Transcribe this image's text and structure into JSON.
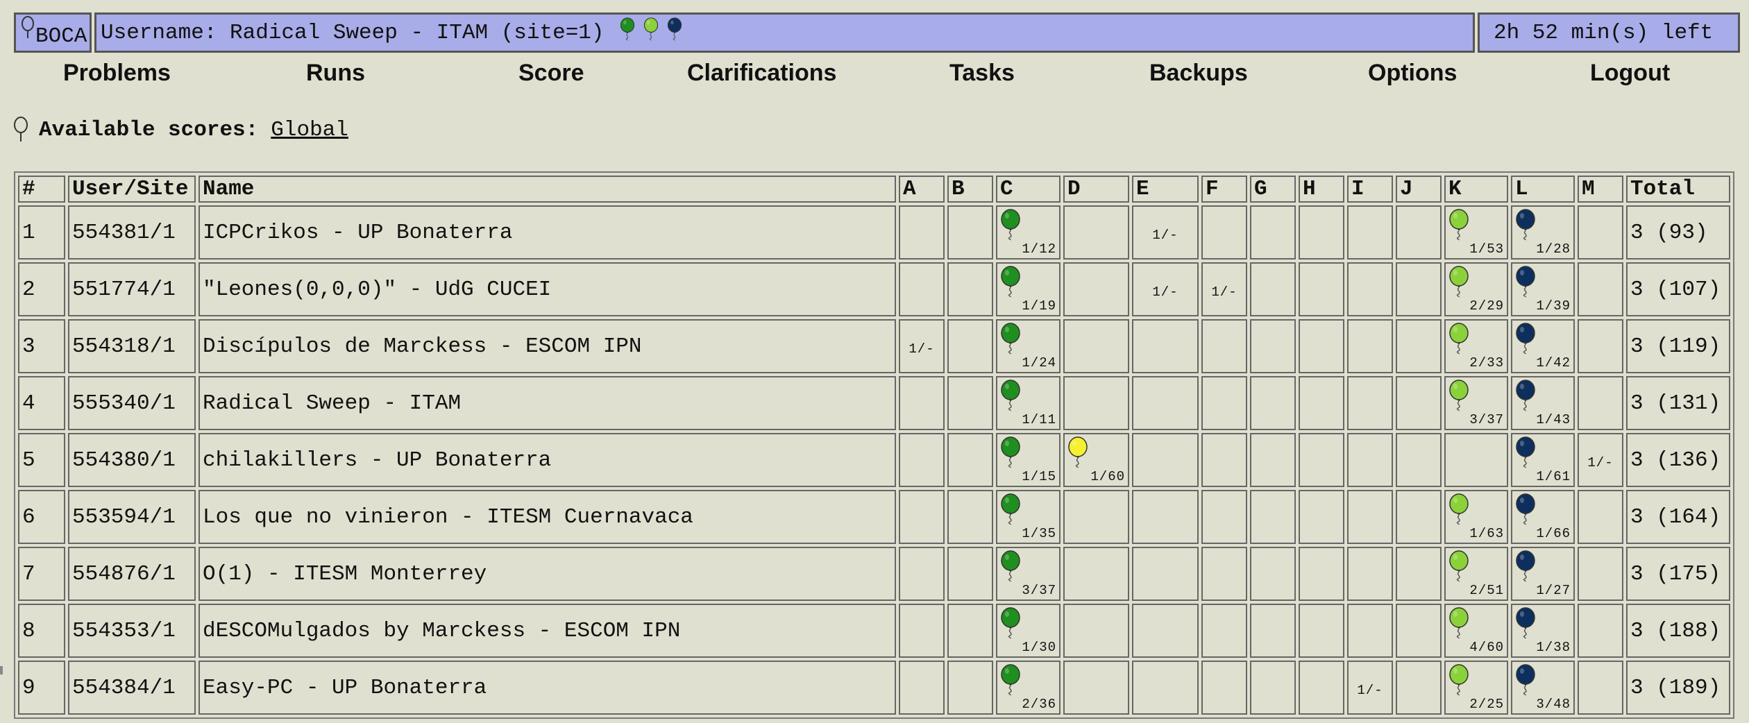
{
  "header": {
    "logo_text": "BOCA",
    "user_line": "Username: Radical Sweep - ITAM (site=1)",
    "user_balloon_colors": [
      "#1f8f1f",
      "#8bd23a",
      "#0d2f5e"
    ],
    "time_left": "2h 52 min(s) left",
    "bar_color": "#a8ace8"
  },
  "nav": {
    "problems": "Problems",
    "runs": "Runs",
    "score": "Score",
    "clarifications": "Clarifications",
    "tasks": "Tasks",
    "backups": "Backups",
    "options": "Options",
    "logout": "Logout"
  },
  "scores": {
    "label": "Available scores:",
    "link": "Global"
  },
  "table": {
    "headers": [
      "#",
      "User/Site",
      "Name",
      "A",
      "B",
      "C",
      "D",
      "E",
      "F",
      "G",
      "H",
      "I",
      "J",
      "K",
      "L",
      "M",
      "Total"
    ],
    "problem_colors": {
      "C": "#1f8f1f",
      "D": "#f5f030",
      "K": "#8bd23a",
      "L": "#0d2f5e"
    },
    "rows": [
      {
        "rank": "1",
        "user": "554381/1",
        "name": "ICPCrikos - UP Bonaterra",
        "total": "3 (93)",
        "cells": {
          "C": "1/12",
          "E": "1/-",
          "K": "1/53",
          "L": "1/28"
        }
      },
      {
        "rank": "2",
        "user": "551774/1",
        "name": "\"Leones(0,0,0)\" - UdG CUCEI",
        "total": "3 (107)",
        "cells": {
          "C": "1/19",
          "E": "1/-",
          "F": "1/-",
          "K": "2/29",
          "L": "1/39"
        }
      },
      {
        "rank": "3",
        "user": "554318/1",
        "name": "Discípulos de Marckess - ESCOM IPN",
        "total": "3 (119)",
        "cells": {
          "A": "1/-",
          "C": "1/24",
          "K": "2/33",
          "L": "1/42"
        }
      },
      {
        "rank": "4",
        "user": "555340/1",
        "name": "Radical Sweep - ITAM",
        "total": "3 (131)",
        "cells": {
          "C": "1/11",
          "K": "3/37",
          "L": "1/43"
        }
      },
      {
        "rank": "5",
        "user": "554380/1",
        "name": "chilakillers - UP Bonaterra",
        "total": "3 (136)",
        "cells": {
          "C": "1/15",
          "D": "1/60",
          "L": "1/61",
          "M": "1/-"
        }
      },
      {
        "rank": "6",
        "user": "553594/1",
        "name": "Los que no vinieron - ITESM Cuernavaca",
        "total": "3 (164)",
        "cells": {
          "C": "1/35",
          "K": "1/63",
          "L": "1/66"
        }
      },
      {
        "rank": "7",
        "user": "554876/1",
        "name": "O(1) - ITESM Monterrey",
        "total": "3 (175)",
        "cells": {
          "C": "3/37",
          "K": "2/51",
          "L": "1/27"
        }
      },
      {
        "rank": "8",
        "user": "554353/1",
        "name": "dESCOMulgados by Marckess - ESCOM IPN",
        "total": "3 (188)",
        "cells": {
          "C": "1/30",
          "K": "4/60",
          "L": "1/38"
        }
      },
      {
        "rank": "9",
        "user": "554384/1",
        "name": "Easy-PC - UP Bonaterra",
        "total": "3 (189)",
        "cells": {
          "C": "2/36",
          "I": "1/-",
          "K": "2/25",
          "L": "3/48"
        }
      }
    ]
  }
}
